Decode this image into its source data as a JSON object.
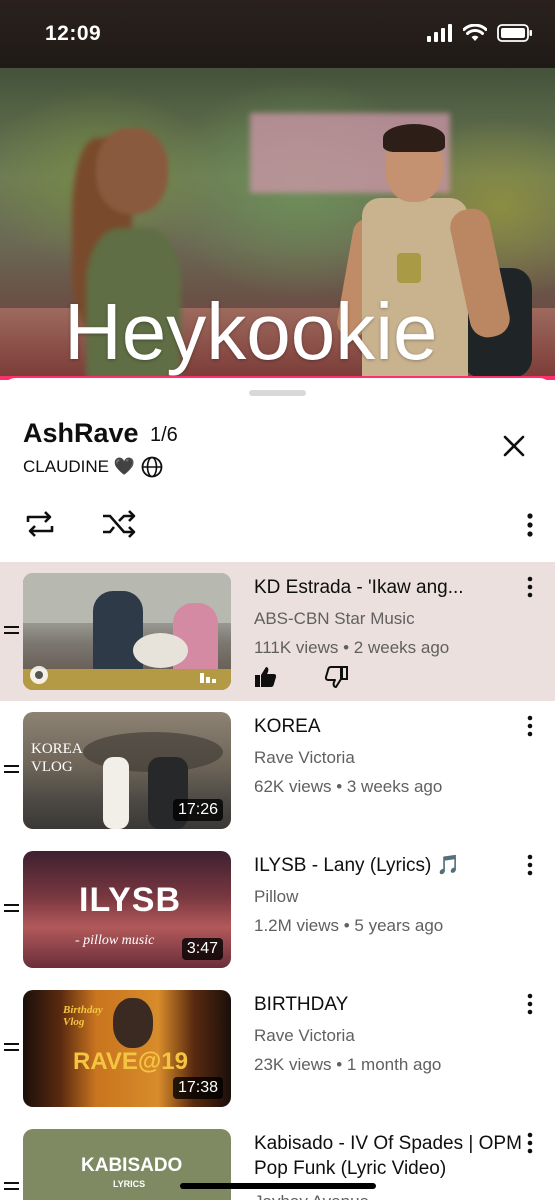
{
  "status_bar": {
    "time": "12:09"
  },
  "player": {
    "overlay_text": "Heykookie",
    "progress_percent": 100,
    "accent_color": "#ff2f6c"
  },
  "playlist": {
    "title": "AshRave",
    "position": "1/6",
    "owner": "CLAUDINE 🖤",
    "owner_icon": "globe-icon",
    "controls": [
      "loop-icon",
      "shuffle-icon",
      "more-vert-icon"
    ]
  },
  "videos": [
    {
      "title": "KD Estrada - 'Ikaw ang...",
      "channel": "ABS-CBN Star Music",
      "meta": "111K views • 2 weeks ago",
      "duration": "",
      "now_playing": true,
      "actions": [
        "thumbs-up-icon",
        "thumbs-down-icon"
      ]
    },
    {
      "title": "KOREA",
      "channel": "Rave Victoria",
      "meta": "62K views • 3 weeks ago",
      "duration": "17:26",
      "thumb_text": "KOREA VLOG"
    },
    {
      "title": "ILYSB - Lany (Lyrics) 🎵",
      "channel": "Pillow",
      "meta": "1.2M views • 5 years ago",
      "duration": "3:47",
      "thumb_text": "ILYSB",
      "thumb_subtext": "- pillow music"
    },
    {
      "title": "BIRTHDAY",
      "channel": "Rave Victoria",
      "meta": "23K views • 1 month ago",
      "duration": "17:38",
      "thumb_text": "RAVE@19",
      "thumb_subtext": "Birthday Vlog"
    },
    {
      "title": "Kabisado - IV Of Spades | OPM Pop Funk (Lyric Video)",
      "channel": "Jayhay Avenue",
      "meta": "",
      "duration": "",
      "thumb_text": "KABISADO",
      "thumb_subtext": "LYRICS"
    }
  ]
}
